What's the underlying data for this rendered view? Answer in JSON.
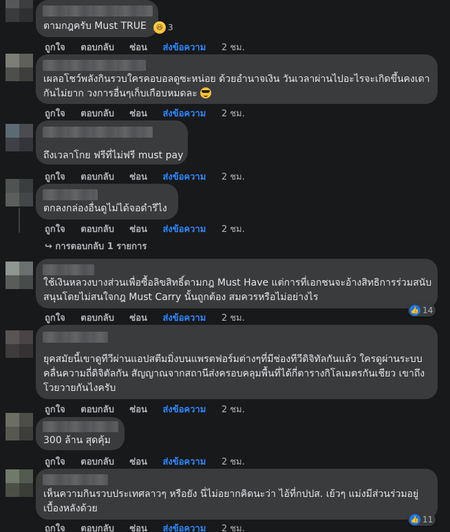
{
  "actions": {
    "like": "ถูกใจ",
    "reply": "ตอบกลับ",
    "hide": "ซ่อน",
    "send_message": "ส่งข้อความ"
  },
  "accent": "#2d88ff",
  "comments": [
    {
      "text": "ตามกฎครับ Must TRUE",
      "emoji": "",
      "time": "2 ชม.",
      "reaction": {
        "icon": "haha-icon",
        "count": "3"
      }
    },
    {
      "text": "เผลอโชว์พลังกินรวบใครคอบอลดูซะหน่อย ด้วยอำนาจเงิน วันเวลาผ่านไปอะไรจะเกิดขึ้นคงเดา\nกันไม่ยาก วงการอื่นๆเก็บเกือบหมดละ",
      "emoji": "sunglasses-emoji",
      "time": "2 ชม.",
      "reaction": null
    },
    {
      "text": "ถึงเวลาโกย ฟรีที่ไม่ฟรี must pay",
      "emoji": "",
      "time": "2 ชม.",
      "reaction": null
    },
    {
      "text": "ตกลงกล่องอื่นดูไม่ได้จอดำรึไง",
      "emoji": "",
      "time": "2 ชม.",
      "reaction": null
    },
    {
      "text": "ใช้เงินหลวงบางส่วนเพื่อซื้อลิขสิทธิ์ตามกฎ Must Have แต่การที่เอกชนจะอ้างสิทธิการร่วมสนับ\nสนุนโดยไม่สนใจกฎ Must Carry นั้นถูกต้อง สมควรหรือไม่อย่างไร",
      "emoji": "",
      "time": "2 ชม.",
      "reaction": {
        "icon": "like-icon",
        "count": "14"
      }
    },
    {
      "text": "ยุคสมัยนี้เขาดูทีวีผ่านแอปสตีมมิ่งบนแพรตฟอร์มต่างๆที่มีช่องทีวีดิจิทัลกันแล้ว ใครดูผ่านระบบ\nคลื่นความถี่ดิจิตัลกัน สัญญาณจากสถานีส่งครอบคลุมพื้นที่ได้กี่ตารางกิโลเมตรกันเชียว เขาถึง\nโวยวายกันไงครับ",
      "emoji": "",
      "time": "2 ชม.",
      "reaction": null
    },
    {
      "text": "300 ล้าน สุดคุ้ม",
      "emoji": "",
      "time": "2 ชม.",
      "reaction": null
    },
    {
      "text": "เห็นความกินรวบประเทศลาวๆ หรือยัง นี่ไม่อยากคิดนะว่า ไอ้ที่กปปส. เย้วๆ แม่งมีส่วนร่วมอยู่\nเบื้องหลังด้วย",
      "emoji": "",
      "time": "2 ชม.",
      "reaction": {
        "icon": "like-icon",
        "count": "11"
      }
    }
  ],
  "replies_link": "↪ การตอบกลับ 1 รายการ"
}
